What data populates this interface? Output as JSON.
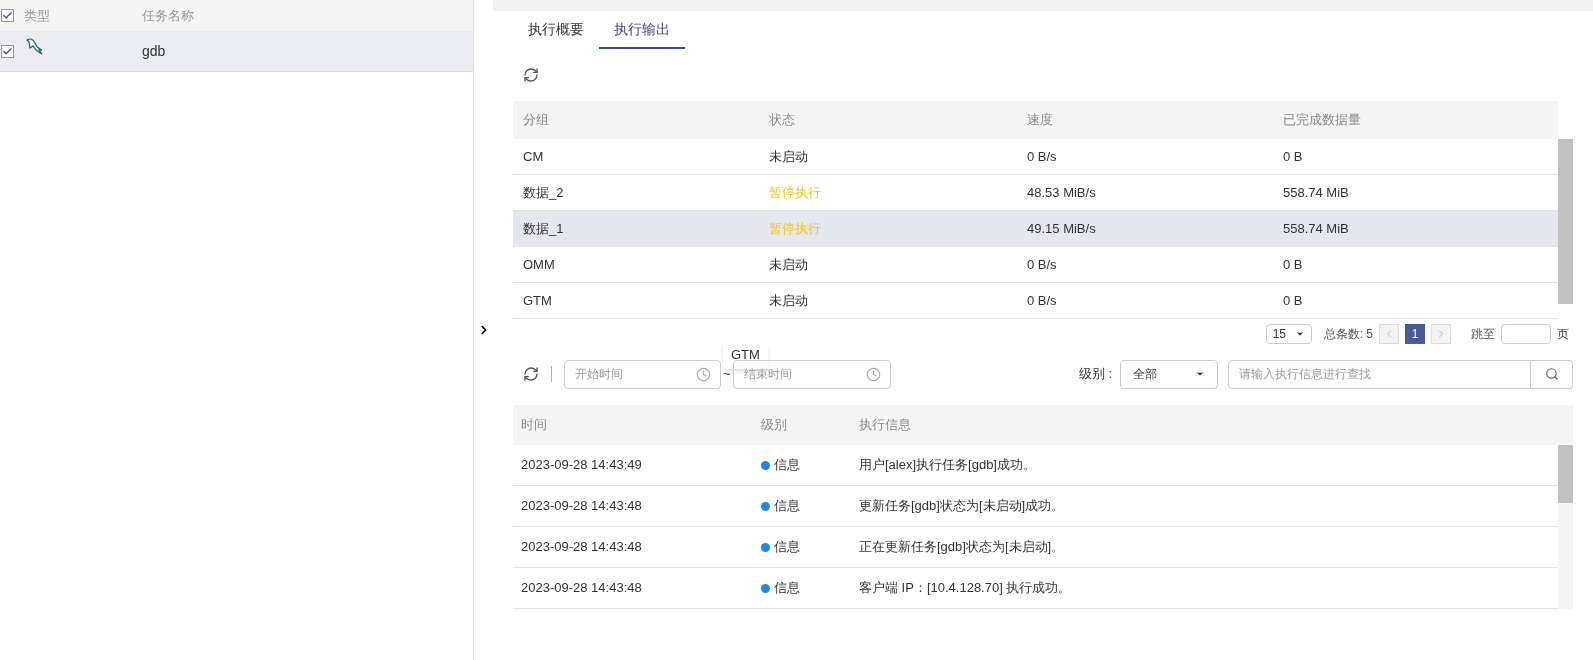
{
  "task_list": {
    "header": {
      "checked": true,
      "columns": [
        "类型",
        "任务名称"
      ]
    },
    "rows": [
      {
        "checked": true,
        "selected": true,
        "name": "gdb"
      }
    ]
  },
  "tabs": [
    {
      "label": "执行概要",
      "selected": false
    },
    {
      "label": "执行输出",
      "selected": true
    }
  ],
  "groups_table": {
    "columns": [
      "分组",
      "状态",
      "速度",
      "已完成数据量"
    ],
    "rows": [
      {
        "group": "CM",
        "status": "未启动",
        "kind": "idle",
        "speed": "0 B/s",
        "done": "0 B",
        "selected": false
      },
      {
        "group": "数据_2",
        "status": "暂停执行",
        "kind": "paused",
        "speed": "48.53 MiB/s",
        "done": "558.74 MiB",
        "selected": false
      },
      {
        "group": "数据_1",
        "status": "暂停执行",
        "kind": "paused",
        "speed": "49.15 MiB/s",
        "done": "558.74 MiB",
        "selected": true
      },
      {
        "group": "OMM",
        "status": "未启动",
        "kind": "idle",
        "speed": "0 B/s",
        "done": "0 B",
        "selected": false
      },
      {
        "group": "GTM",
        "status": "未启动",
        "kind": "idle",
        "speed": "0 B/s",
        "done": "0 B",
        "selected": false
      }
    ]
  },
  "pagination": {
    "page_size": "15",
    "total": "总条数: 5",
    "pages": [
      {
        "label": "1",
        "selected": true
      }
    ],
    "jump_label": "跳至",
    "page_unit": "页"
  },
  "tooltip": "GTM",
  "log_filter": {
    "start_placeholder": "开始时间",
    "separator": "~",
    "end_placeholder": "结束时间",
    "level_label": "级别 :",
    "level_value": "全部",
    "search_placeholder": "请输入执行信息进行查找"
  },
  "log_table": {
    "columns": [
      "时间",
      "级别",
      "执行信息"
    ],
    "rows": [
      {
        "time": "2023-09-28 14:43:49",
        "level": "信息",
        "color": "#1e88e5",
        "message": "用户[alex]执行任务[gdb]成功。"
      },
      {
        "time": "2023-09-28 14:43:48",
        "level": "信息",
        "color": "#1e88e5",
        "message": "更新任务[gdb]状态为[未启动]成功。"
      },
      {
        "time": "2023-09-28 14:43:48",
        "level": "信息",
        "color": "#1e88e5",
        "message": "正在更新任务[gdb]状态为[未启动]。"
      },
      {
        "time": "2023-09-28 14:43:48",
        "level": "信息",
        "color": "#1e88e5",
        "message": "客户端 IP：[10.4.128.70] 执行成功。"
      }
    ]
  }
}
